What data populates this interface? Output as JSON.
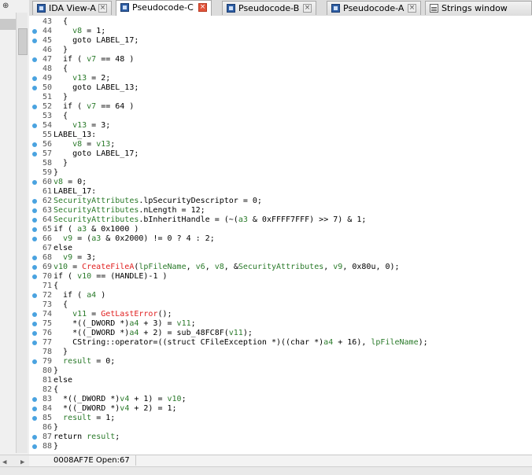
{
  "tabs": [
    {
      "label": "IDA View-A",
      "icon": "ida-view-icon",
      "active": false
    },
    {
      "label": "Pseudocode-C",
      "icon": "pseudocode-icon",
      "active": true
    },
    {
      "label": "Pseudocode-B",
      "icon": "pseudocode-icon",
      "active": false
    },
    {
      "label": "Pseudocode-A",
      "icon": "pseudocode-icon",
      "active": false
    },
    {
      "label": "Strings window",
      "icon": "strings-icon",
      "active": false
    }
  ],
  "close_glyph": "×",
  "left_panel": {
    "pin_glyph": "⊕"
  },
  "code_lines": [
    {
      "num": "43",
      "dot": false,
      "html": "  {"
    },
    {
      "num": "44",
      "dot": true,
      "html": "    <span class=\"v\">v8</span> = 1;"
    },
    {
      "num": "45",
      "dot": true,
      "html": "    goto LABEL_17;"
    },
    {
      "num": "46",
      "dot": false,
      "html": "  }"
    },
    {
      "num": "47",
      "dot": true,
      "html": "  if ( <span class=\"v\">v7</span> == 48 )"
    },
    {
      "num": "48",
      "dot": false,
      "html": "  {"
    },
    {
      "num": "49",
      "dot": true,
      "html": "    <span class=\"v\">v13</span> = 2;"
    },
    {
      "num": "50",
      "dot": true,
      "html": "    goto LABEL_13;"
    },
    {
      "num": "51",
      "dot": false,
      "html": "  }"
    },
    {
      "num": "52",
      "dot": true,
      "html": "  if ( <span class=\"v\">v7</span> == 64 )"
    },
    {
      "num": "53",
      "dot": false,
      "html": "  {"
    },
    {
      "num": "54",
      "dot": true,
      "html": "    <span class=\"v\">v13</span> = 3;"
    },
    {
      "num": "55",
      "dot": false,
      "html": "LABEL_13:"
    },
    {
      "num": "56",
      "dot": true,
      "html": "    <span class=\"v\">v8</span> = <span class=\"v\">v13</span>;"
    },
    {
      "num": "57",
      "dot": true,
      "html": "    goto LABEL_17;"
    },
    {
      "num": "58",
      "dot": false,
      "html": "  }"
    },
    {
      "num": "59",
      "dot": false,
      "html": "}"
    },
    {
      "num": "60",
      "dot": true,
      "html": "<span class=\"v\">v8</span> = 0;"
    },
    {
      "num": "61",
      "dot": false,
      "html": "LABEL_17:"
    },
    {
      "num": "62",
      "dot": true,
      "html": "<span class=\"v\">SecurityAttributes</span>.lpSecurityDescriptor = 0;"
    },
    {
      "num": "63",
      "dot": true,
      "html": "<span class=\"v\">SecurityAttributes</span>.nLength = 12;"
    },
    {
      "num": "64",
      "dot": true,
      "html": "<span class=\"v\">SecurityAttributes</span>.bInheritHandle = (~(<span class=\"v\">a3</span> &amp; 0xFFFF7FFF) &gt;&gt; 7) &amp; 1;"
    },
    {
      "num": "65",
      "dot": true,
      "html": "if ( <span class=\"v\">a3</span> &amp; 0x1000 )"
    },
    {
      "num": "66",
      "dot": true,
      "html": "  <span class=\"v\">v9</span> = (<span class=\"v\">a3</span> &amp; 0x2000) != 0 ? 4 : 2;"
    },
    {
      "num": "67",
      "dot": false,
      "html": "else"
    },
    {
      "num": "68",
      "dot": true,
      "html": "  <span class=\"v\">v9</span> = 3;"
    },
    {
      "num": "69",
      "dot": true,
      "html": "<span class=\"v\">v10</span> = <span class=\"f\">CreateFileA</span>(<span class=\"v\">lpFileName</span>, <span class=\"v\">v6</span>, <span class=\"v\">v8</span>, &amp;<span class=\"v\">SecurityAttributes</span>, <span class=\"v\">v9</span>, 0x80u, 0);"
    },
    {
      "num": "70",
      "dot": true,
      "html": "if ( <span class=\"v\">v10</span> == (HANDLE)-1 )"
    },
    {
      "num": "71",
      "dot": false,
      "html": "{"
    },
    {
      "num": "72",
      "dot": true,
      "html": "  if ( <span class=\"v\">a4</span> )"
    },
    {
      "num": "73",
      "dot": false,
      "html": "  {"
    },
    {
      "num": "74",
      "dot": true,
      "html": "    <span class=\"v\">v11</span> = <span class=\"f\">GetLastError</span>();"
    },
    {
      "num": "75",
      "dot": true,
      "html": "    *((_DWORD *)<span class=\"v\">a4</span> + 3) = <span class=\"v\">v11</span>;"
    },
    {
      "num": "76",
      "dot": true,
      "html": "    *((_DWORD *)<span class=\"v\">a4</span> + 2) = sub_48FC8F(<span class=\"v\">v11</span>);"
    },
    {
      "num": "77",
      "dot": true,
      "html": "    CString::operator=((struct CFileException *)((char *)<span class=\"v\">a4</span> + 16), <span class=\"v\">lpFileName</span>);"
    },
    {
      "num": "78",
      "dot": false,
      "html": "  }"
    },
    {
      "num": "79",
      "dot": true,
      "html": "  <span class=\"v\">result</span> = 0;"
    },
    {
      "num": "80",
      "dot": false,
      "html": "}"
    },
    {
      "num": "81",
      "dot": false,
      "html": "else"
    },
    {
      "num": "82",
      "dot": false,
      "html": "{"
    },
    {
      "num": "83",
      "dot": true,
      "html": "  *((_DWORD *)<span class=\"v\">v4</span> + 1) = <span class=\"v\">v10</span>;"
    },
    {
      "num": "84",
      "dot": true,
      "html": "  *((_DWORD *)<span class=\"v\">v4</span> + 2) = 1;"
    },
    {
      "num": "85",
      "dot": true,
      "html": "  <span class=\"v\">result</span> = 1;"
    },
    {
      "num": "86",
      "dot": false,
      "html": "}"
    },
    {
      "num": "87",
      "dot": true,
      "html": "return <span class=\"v\">result</span>;"
    },
    {
      "num": "88",
      "dot": true,
      "html": "}"
    }
  ],
  "status": {
    "address": "0008AF7E",
    "text": "Open:67"
  },
  "colors": {
    "variable": "#2a7a2a",
    "function_call": "#e02020",
    "gutter_dot": "#4aa3e0",
    "active_close": "#e2533a"
  }
}
